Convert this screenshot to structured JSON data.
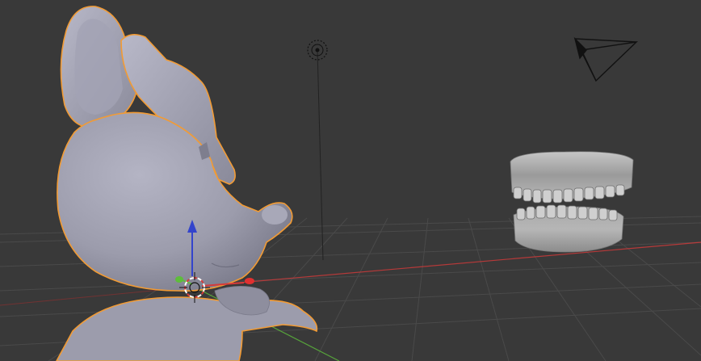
{
  "viewport": {
    "mode": "3D View",
    "background_color": "#393939",
    "grid_color": "#4a4a4a",
    "selection_outline_color": "#f29b34",
    "mesh_color": "#a3a3b3"
  },
  "axes": {
    "x_color": "#d63a3a",
    "y_color": "#5ebd3b",
    "z_color": "#3344cc"
  },
  "objects": [
    {
      "name": "rabbit",
      "selected": true
    },
    {
      "name": "teeth",
      "selected": false
    },
    {
      "name": "lamp",
      "selected": false
    },
    {
      "name": "camera",
      "selected": false
    }
  ],
  "gizmo": {
    "icon": "transform-arrows-icon"
  },
  "cursor_3d": {
    "icon": "crosshair-icon"
  }
}
